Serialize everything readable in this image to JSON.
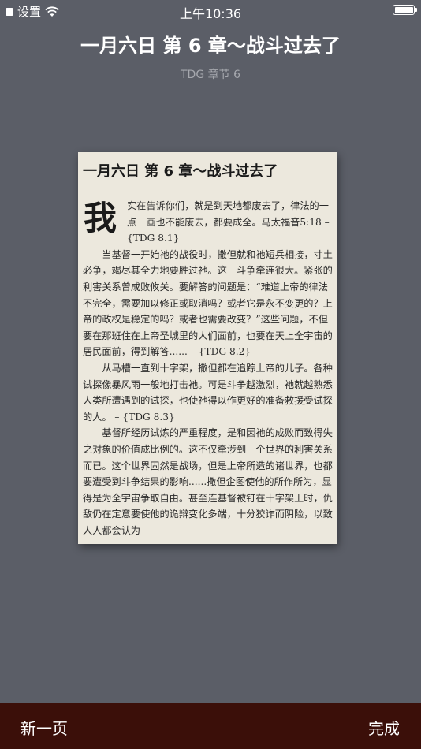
{
  "status_bar": {
    "carrier": "设置",
    "time": "上午10:36",
    "wifi_icon": "wifi-icon",
    "battery_icon": "battery-icon"
  },
  "header": {
    "title": "一月六日 第 6 章～战斗过去了",
    "subtitle": "TDG 章节 6"
  },
  "page": {
    "title": "一月六日 第 6 章～战斗过去了",
    "dropcap": "我",
    "paragraph_1": "实在告诉你们，就是到天地都废去了，律法的一点一画也不能废去，都要成全。马太福音5:18 – {TDG 8.1}",
    "paragraph_2": "当基督一开始祂的战役时，撒但就和祂短兵相接，寸土必争，竭尽其全力地要胜过祂。这一斗争牵连很大。紧张的利害关系曾成败攸关。要解答的问题是：“难道上帝的律法不完全，需要加以修正或取消吗？或者它是永不变更的？上帝的政权是稳定的吗？或者也需要改变？”这些问题，不但要在那班住在上帝圣城里的人们面前，也要在天上全宇宙的居民面前，得到解答...... – {TDG 8.2}",
    "paragraph_3": "从马槽一直到十字架，撒但都在追踪上帝的儿子。各种试探像暴风雨一般地打击祂。可是斗争越激烈，祂就越熟悉人类所遭遇到的试探，也使祂得以作更好的准备救援受试探的人。 – {TDG 8.3}",
    "paragraph_4": "基督所经历试炼的严重程度，是和因祂的成败而致得失之对象的价值成比例的。这不仅牵涉到一个世界的利害关系而已。这个世界固然是战场，但是上帝所造的诸世界，也都要遭受到斗争结果的影响......撒但企图使他的所作所为，显得是为全宇宙争取自由。甚至连基督被钉在十字架上时，仇敌仍在定意要使他的诡辩变化多端，十分狡诈而阴险，以致人人都会认为"
  },
  "bottom_bar": {
    "new_page_label": "新一页",
    "done_label": "完成",
    "background": "#3b0f09"
  }
}
